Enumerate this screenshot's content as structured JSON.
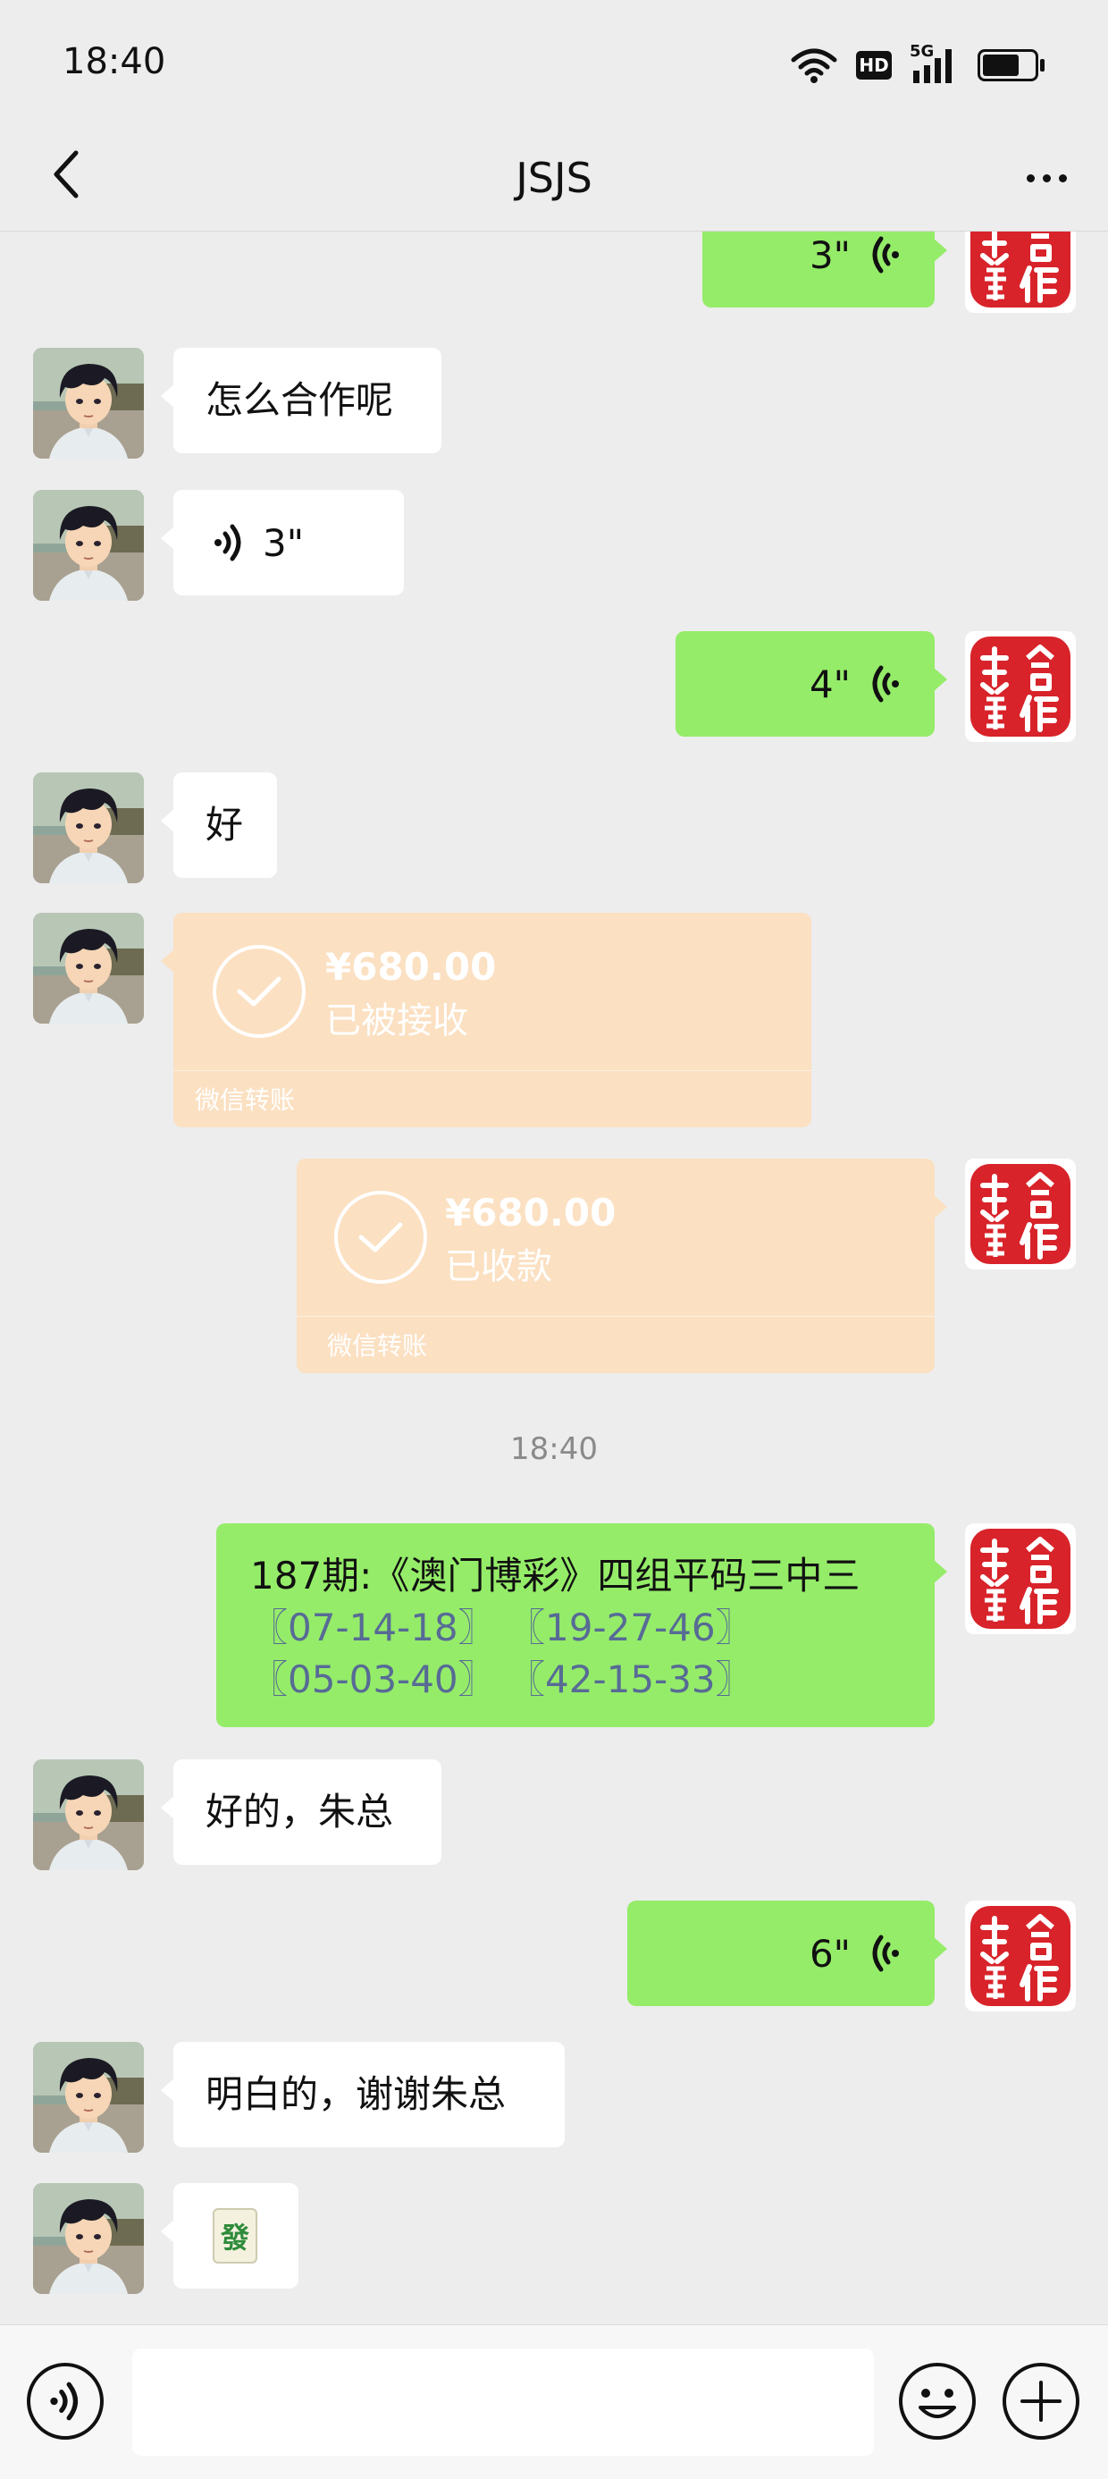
{
  "status_bar": {
    "time": "18:40",
    "network": "5G",
    "hd": "HD"
  },
  "nav": {
    "title": "JSJS",
    "back_icon": "chevron-left-icon",
    "more_icon": "more-dots-icon"
  },
  "seal_text": "共赢合作",
  "messages": [
    {
      "side": "right",
      "type": "voice",
      "duration": "3\""
    },
    {
      "side": "left",
      "type": "text",
      "text": "怎么合作呢"
    },
    {
      "side": "left",
      "type": "voice",
      "duration": "3\""
    },
    {
      "side": "right",
      "type": "voice",
      "duration": "4\""
    },
    {
      "side": "left",
      "type": "text",
      "text": "好"
    },
    {
      "side": "left",
      "type": "transfer",
      "amount": "¥680.00",
      "status": "已被接收",
      "label": "微信转账"
    },
    {
      "side": "right",
      "type": "transfer",
      "amount": "¥680.00",
      "status": "已收款",
      "label": "微信转账"
    },
    {
      "side": "right",
      "type": "text",
      "line1": "187期:《澳门博彩》四组平码三中三",
      "codes": [
        "〖07-14-18〗",
        "〖19-27-46〗",
        "〖05-03-40〗",
        "〖42-15-33〗"
      ]
    },
    {
      "side": "left",
      "type": "text",
      "text": "好的，朱总"
    },
    {
      "side": "right",
      "type": "voice",
      "duration": "6\""
    },
    {
      "side": "left",
      "type": "text",
      "text": "明白的，谢谢朱总"
    },
    {
      "side": "left",
      "type": "emoji",
      "emoji": "🀅"
    }
  ],
  "timestamp": "18:40",
  "input_bar": {
    "value": "",
    "voice_icon": "voice-mode-icon",
    "emoji_icon": "emoji-icon",
    "plus_icon": "plus-icon"
  },
  "colors": {
    "background": "#ededed",
    "green_bubble": "#95ec69",
    "white_bubble": "#ffffff",
    "transfer_bubble": "#fbe0c2",
    "link": "#576b95",
    "seal_red": "#d8232a"
  }
}
